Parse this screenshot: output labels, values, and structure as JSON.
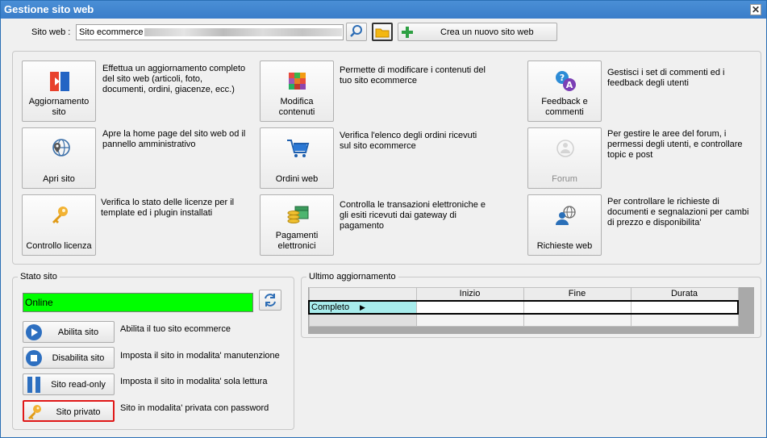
{
  "window": {
    "title": "Gestione sito web",
    "close": "✕"
  },
  "site": {
    "label": "Sito web :",
    "value": "Sito ecommerce",
    "new_site": "Crea un nuovo sito web"
  },
  "tiles": {
    "aggiornamento": {
      "label": "Aggiornamento\nsito",
      "desc": "Effettua un aggiornamento completo\ndel sito web (articoli, foto,\ndocumenti, ordini, giacenze, ecc.)"
    },
    "apri": {
      "label": "Apri sito",
      "desc": "Apre la home page del sito web od il\npannello amministrativo"
    },
    "licenza": {
      "label": "Controllo licenza",
      "desc": "Verifica lo stato delle licenze per il\ntemplate ed i plugin installati"
    },
    "modifica": {
      "label": "Modifica\ncontenuti",
      "desc": "Permette di modificare i contenuti del\ntuo sito ecommerce"
    },
    "ordini": {
      "label": "Ordini web",
      "desc": "Verifica l'elenco degli ordini ricevuti\nsul sito ecommerce"
    },
    "pagamenti": {
      "label": "Pagamenti\nelettronici",
      "desc": "Controlla le transazioni elettroniche e\ngli esiti ricevuti dai gateway di\npagamento"
    },
    "feedback": {
      "label": "Feedback e\ncommenti",
      "desc": "Gestisci i set di commenti ed i\nfeedback degli utenti"
    },
    "forum": {
      "label": "Forum",
      "desc": "Per gestire le aree del forum, i\npermessi degli utenti, e controllare\ntopic e post"
    },
    "richieste": {
      "label": "Richieste web",
      "desc": "Per controllare le richieste di\ndocumenti e segnalazioni per cambi\ndi prezzo e disponibilita'"
    }
  },
  "stato": {
    "title": "Stato sito",
    "status": "Online",
    "status_color": "#00ff00",
    "actions": [
      {
        "label": "Abilita sito",
        "desc": "Abilita il tuo sito ecommerce"
      },
      {
        "label": "Disabilita sito",
        "desc": "Imposta il sito in modalita' manutenzione"
      },
      {
        "label": "Sito read-only",
        "desc": "Imposta il sito in modalita' sola lettura"
      },
      {
        "label": "Sito privato",
        "desc": "Sito in modalita' privata con password"
      }
    ]
  },
  "ultimo": {
    "title": "Ultimo aggiornamento",
    "columns": [
      "Inizio",
      "Fine",
      "Durata"
    ],
    "rows": [
      {
        "name": "Completo",
        "inizio": "",
        "fine": "",
        "durata": ""
      }
    ]
  }
}
